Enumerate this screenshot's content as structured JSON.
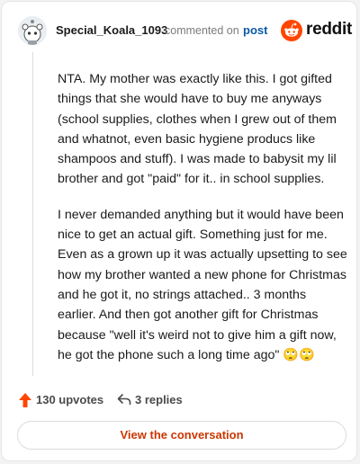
{
  "header": {
    "author": "Special_Koala_1093",
    "commented_on": "commented on",
    "post_link": "post",
    "brand": "reddit",
    "brand_color": "#ff4500"
  },
  "comment": {
    "paragraphs": [
      "NTA. My mother was exactly like this. I got gifted things that she would have to buy me anyways (school supplies, clothes when I grew out of them and whatnot, even basic hygiene producs like shampoos and stuff). I was made to babysit my lil brother and got \"paid\" for it.. in school supplies.",
      "I never demanded anything but it would have been nice to get an actual gift. Something just for me. Even as a grown up it was actually upsetting to see how my brother wanted a new phone for Christmas and he got it, no strings attached.. 3 months earlier. And then got another gift for Christmas because \"well it's weird not to give him a gift now, he got the phone such a long time ago\" 🙄🙄"
    ]
  },
  "actions": {
    "upvotes": "130 upvotes",
    "replies": "3 replies",
    "upvote_color": "#ff4500"
  },
  "footer": {
    "button_label": "View the conversation"
  }
}
